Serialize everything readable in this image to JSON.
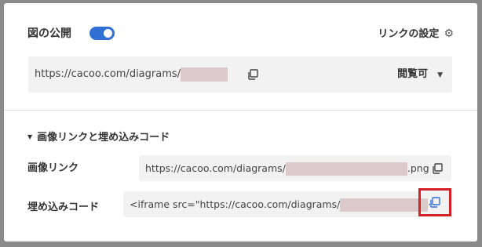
{
  "header": {
    "title": "図の公開",
    "toggle_on": true,
    "link_settings_label": "リンクの設定"
  },
  "share_url": {
    "prefix": "https://cacoo.com/diagrams/",
    "permission": "閲覧可"
  },
  "embed_section": {
    "heading": "画像リンクと埋め込みコード",
    "image_link": {
      "label": "画像リンク",
      "prefix": "https://cacoo.com/diagrams/",
      "suffix": ".png"
    },
    "embed_code": {
      "label": "埋め込みコード",
      "prefix": "<iframe src=\"https://cacoo.com/diagrams/",
      "suffix": "·"
    }
  },
  "colors": {
    "accent": "#2f6fd6",
    "highlight_border": "#d32027",
    "redaction": "#dcc9c9",
    "field_background": "#f2f2f2"
  },
  "icons": {
    "copy": "copy-icon",
    "gear": "gear-icon",
    "dropdown": "caret-down-icon",
    "section_toggle": "triangle-down-icon"
  }
}
